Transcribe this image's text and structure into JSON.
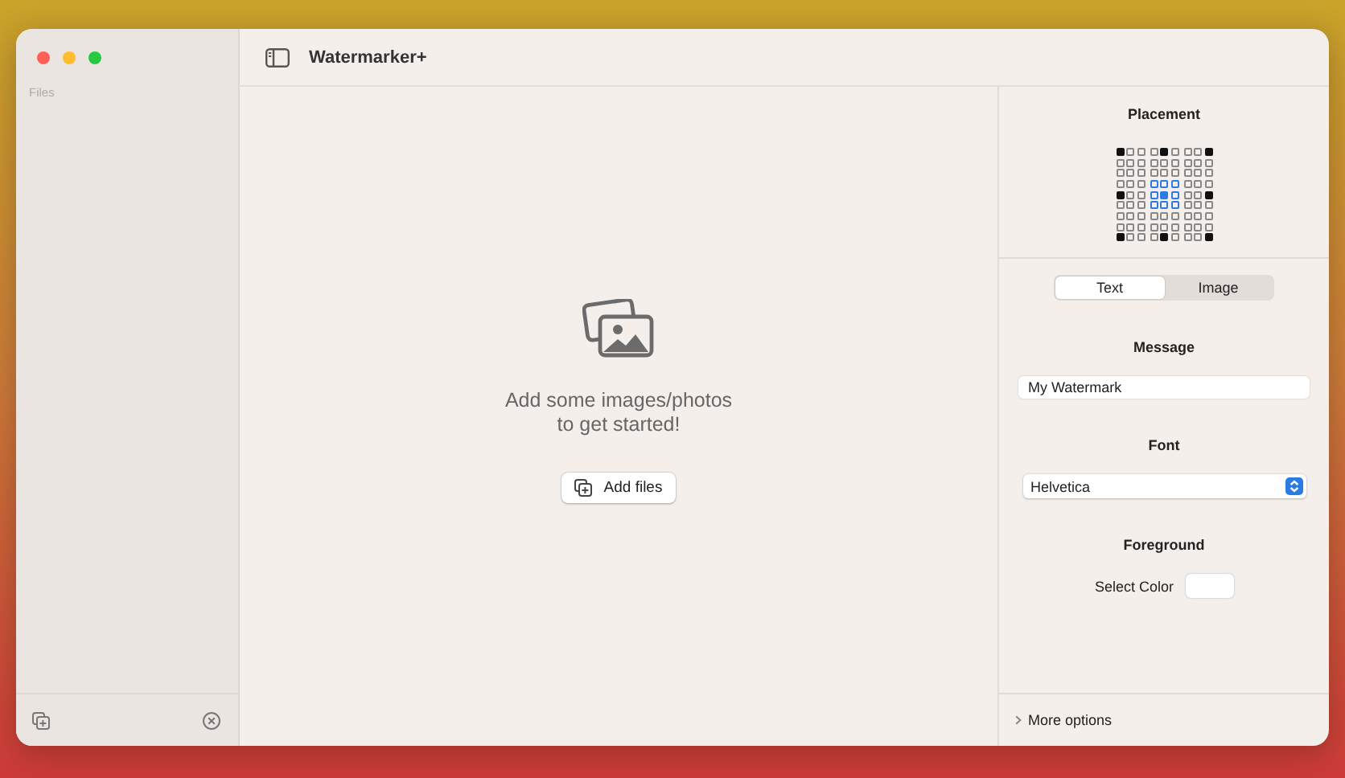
{
  "window": {
    "title": "Watermarker+"
  },
  "sidebar": {
    "heading": "Files"
  },
  "drop_area": {
    "message": "Add some images/photos\nto get started!",
    "button": "Add files"
  },
  "placement": {
    "title": "Placement",
    "positions": [
      {
        "selected": false
      },
      {
        "selected": false
      },
      {
        "selected": false
      },
      {
        "selected": false
      },
      {
        "selected": true
      },
      {
        "selected": false
      },
      {
        "selected": false
      },
      {
        "selected": false
      },
      {
        "selected": false
      }
    ]
  },
  "mode_tabs": [
    {
      "label": "Text",
      "selected": true
    },
    {
      "label": "Image",
      "selected": false
    }
  ],
  "message": {
    "title": "Message",
    "value": "My Watermark"
  },
  "font": {
    "title": "Font",
    "value": "Helvetica"
  },
  "foreground": {
    "title": "Foreground",
    "label": "Select Color",
    "color": "#ffffff"
  },
  "more_options": {
    "label": "More options",
    "expanded": false
  }
}
